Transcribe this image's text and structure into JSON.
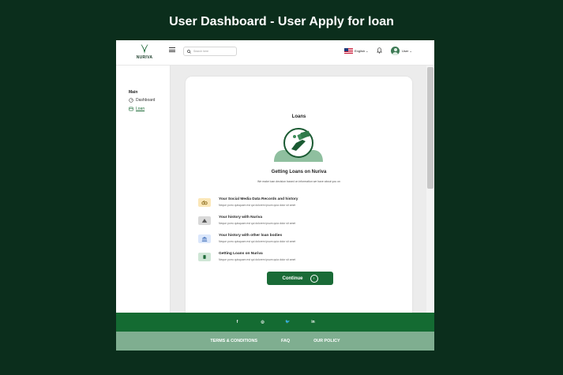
{
  "hero": {
    "title": "User Dashboard - User Apply for loan"
  },
  "header": {
    "brand": "NURIVA",
    "search_placeholder": "Search here",
    "language": "English",
    "language_icon": "us-flag-icon",
    "bell_icon": "bell-icon",
    "user_label": "User"
  },
  "sidebar": {
    "section": "Main",
    "items": [
      {
        "label": "Dashboard",
        "icon": "dashboard-icon",
        "active": false
      },
      {
        "label": "Loan",
        "icon": "loan-icon",
        "active": true
      }
    ]
  },
  "card": {
    "title": "Loans",
    "subtitle": "Getting Loans on Nuriva",
    "description": "We make loan decision based on information we have about you on",
    "features": [
      {
        "title": "Your Social Media Data Records and history",
        "desc": "Neque porro quisquam est qui dolorem ipsum quia dolor sit amet",
        "icon": "social-icon",
        "color": "#fbe7b8"
      },
      {
        "title": "Your history with Nuriva",
        "desc": "Neque porro quisquam est qui dolorem ipsum quia dolor sit amet",
        "icon": "history-icon",
        "color": "#d9d9d9"
      },
      {
        "title": "Your history with other loan bodies",
        "desc": "Neque porro quisquam est qui dolorem ipsum quia dolor sit amet",
        "icon": "bank-icon",
        "color": "#dbe7fb"
      },
      {
        "title": "Getting Loans on Nuriva",
        "desc": "Neque porro quisquam est qui dolorem ipsum quia dolor sit amet",
        "icon": "money-icon",
        "color": "#cfe6d6"
      }
    ],
    "continue_label": "Continue"
  },
  "footer": {
    "social": [
      {
        "label": "f",
        "icon": "facebook-icon"
      },
      {
        "label": "◎",
        "icon": "instagram-icon"
      },
      {
        "label": "🐦",
        "icon": "twitter-icon"
      },
      {
        "label": "in",
        "icon": "linkedin-icon"
      }
    ],
    "links": [
      "TERMS & CONDITIONS",
      "FAQ",
      "OUR POLICY"
    ]
  },
  "colors": {
    "background": "#0b2e1c",
    "brand_green": "#1a6b37",
    "footer_dark": "#146b32",
    "footer_light": "#7fae90"
  }
}
